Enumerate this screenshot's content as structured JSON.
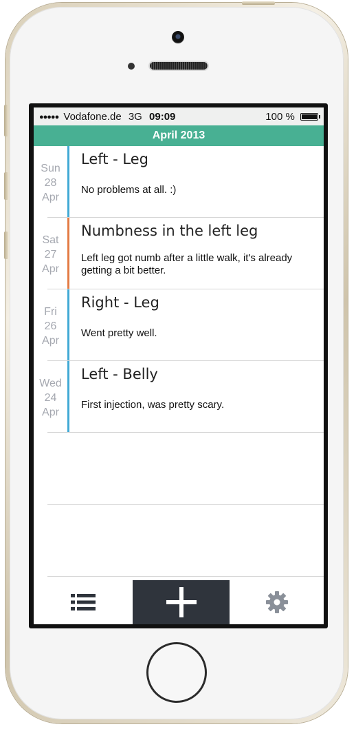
{
  "status_bar": {
    "signal": "●●●●●",
    "carrier": "Vodafone.de",
    "network": "3G",
    "time": "09:09",
    "battery": "100 %"
  },
  "header": {
    "month": "April 2013"
  },
  "entries": [
    {
      "weekday": "Sun",
      "day": "28",
      "month": "Apr",
      "title": "Left - Leg",
      "note": "No problems at all. :)",
      "color": "#40a9d5"
    },
    {
      "weekday": "Sat",
      "day": "27",
      "month": "Apr",
      "title": "Numbness in the left leg",
      "note": "Left leg got numb after a little walk, it's already getting a bit better.",
      "color": "#e37b44"
    },
    {
      "weekday": "Fri",
      "day": "26",
      "month": "Apr",
      "title": "Right - Leg",
      "note": "Went pretty well.",
      "color": "#40a9d5"
    },
    {
      "weekday": "Wed",
      "day": "24",
      "month": "Apr",
      "title": "Left - Belly",
      "note": "First injection, was pretty scary.",
      "color": "#40a9d5"
    }
  ],
  "tab_bar": {
    "tabs": [
      {
        "name": "list",
        "icon": "list-icon"
      },
      {
        "name": "add",
        "icon": "plus-icon"
      },
      {
        "name": "settings",
        "icon": "gear-icon"
      }
    ]
  },
  "colors": {
    "accent": "#48b093",
    "tab_active_bg": "#2f343c",
    "icon": "#2f343c",
    "settings_icon": "#8a9099"
  }
}
